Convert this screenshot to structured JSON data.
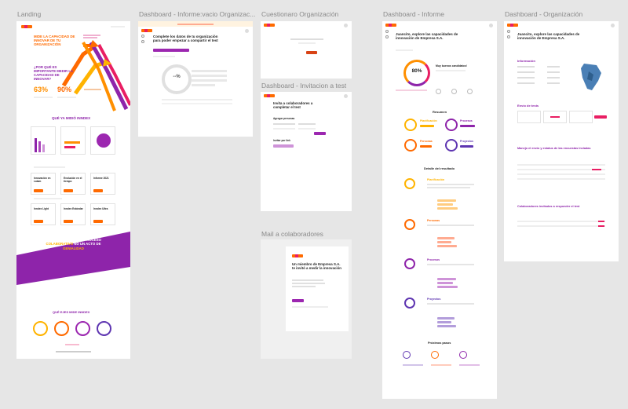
{
  "frames": {
    "landing": "Landing",
    "dash_empty": "Dashboard - Informe:vacio Organizac...",
    "cuestionario": "Cuestionaro Organización",
    "invitacion": "Dashboard - Invitacion a test",
    "mail": "Mail a colaboradores",
    "dash_informe": "Dashboard - Informe",
    "dash_org": "Dashboard - Organización"
  },
  "landing": {
    "hero_title": "MIDE LA CAPACIDAD DE INNOVAR DE TU ORGANIZACIÓN",
    "why_title": "¿POR QUÉ ES IMPORTANTE MEDIR LA CAPACIDAD DE INNOVAR?",
    "stat1": "63%",
    "stat2": "90%",
    "what_title": "QUÉ YA MIDIÓ INNDEX",
    "card1": "Innovación en Latam",
    "card2": "Evolución en el tiempo",
    "card3": "Informe 2021",
    "card4": "Inndex Light",
    "card5": "Inndex Estándar",
    "card6": "Inndex Ultra",
    "banner_line1": "LA INNOVACIÓN ES UN PROCESO",
    "banner_highlight": "COLABORATIVO",
    "banner_line2": "NO UN ACTO DE",
    "banner_highlight2": "GENIALIDAD",
    "axes_title": "QUÉ EJES MIDE INNDEX"
  },
  "dash_empty": {
    "title": "Complete los datos de tu organización para poder empezar a compartir el test",
    "ring_value": "--%"
  },
  "invitacion": {
    "title": "Invita a colaboradores a completar el test",
    "section1": "Agregar personas",
    "section2": "Invitar por link"
  },
  "mail": {
    "title": "Un miembro de Empresa S.A. te invitó a medir la innovación"
  },
  "dash_informe": {
    "title": "Juancito, explore las capacidades de innovación de Empresa S.A.",
    "ring_value": "80%",
    "ring_caption": "Muy buenos candidatos!",
    "resumen": "Resumen",
    "cat1": "Planificación",
    "cat2": "Procesos",
    "cat3": "Personas",
    "cat4": "Proyectos",
    "detalle": "Detalle del resultado",
    "proximos": "Próximos pasos"
  },
  "dash_org": {
    "title": "Juancito, explore las capacidades de innovación de Empresa S.A.",
    "informacion": "Información",
    "envio": "Envío de tests",
    "manejo": "Manejo el envío y estatus de las encuestas Inviadas",
    "invitados": "Colaboradores invitados a responder el test"
  },
  "chart_data": {
    "type": "bar",
    "title": "",
    "categories": [
      "Planificación",
      "Procesos",
      "Personas",
      "Proyectos"
    ],
    "values": [
      68,
      72,
      58,
      64
    ]
  }
}
